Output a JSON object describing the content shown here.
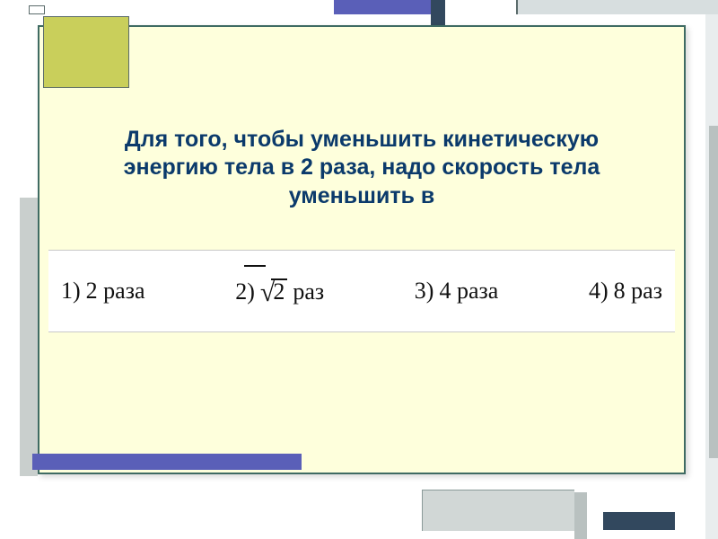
{
  "question": {
    "line1": "Для того, чтобы уменьшить кинетическую",
    "line2": "энергию тела в 2 раза, надо скорость тела",
    "line3": "уменьшить в"
  },
  "answers": {
    "opt1": {
      "num": "1)",
      "text": "2 раза"
    },
    "opt2": {
      "num": "2)",
      "radicand": "2",
      "unit": "раз"
    },
    "opt3": {
      "num": "3)",
      "text": "4 раза"
    },
    "opt4": {
      "num": "4)",
      "text": "8 раз"
    }
  }
}
